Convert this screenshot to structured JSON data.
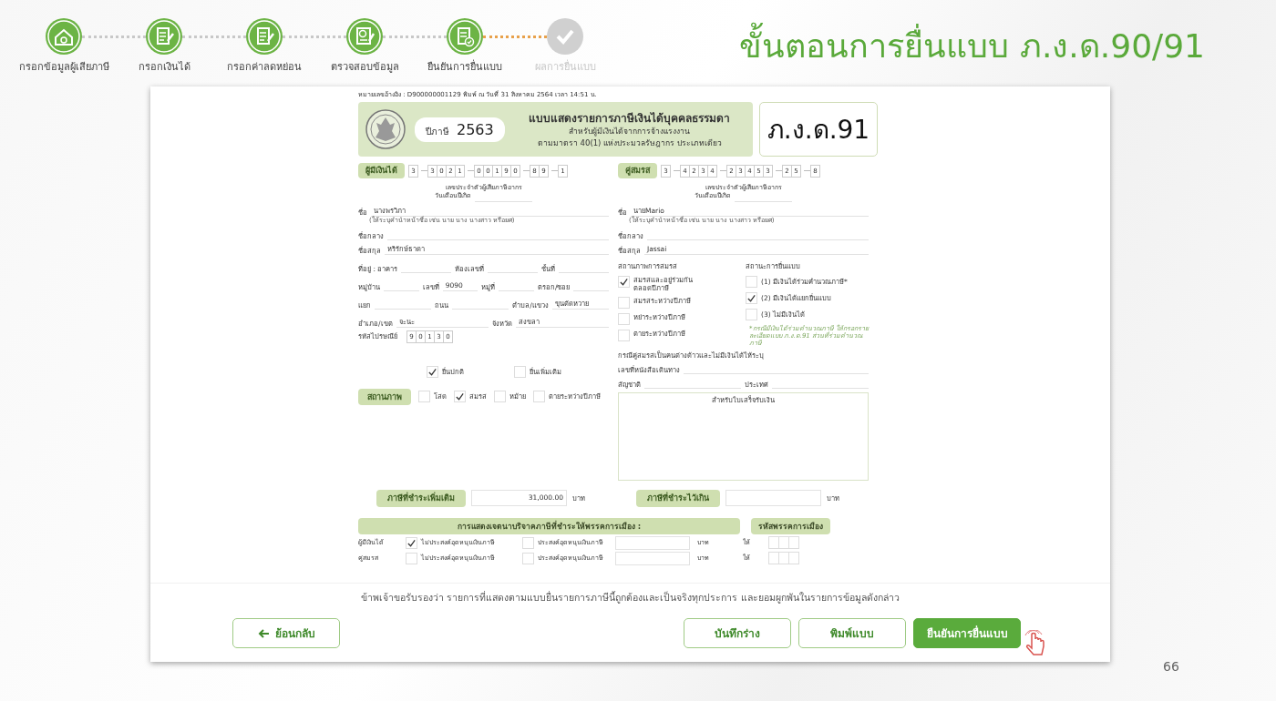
{
  "slide": {
    "title": "ขั้นตอนการยื่นแบบ ภ.ง.ด.90/91",
    "page_number": "66"
  },
  "steps": [
    {
      "label": "กรอกข้อมูลผู้เสียภาษี",
      "completed": true
    },
    {
      "label": "กรอกเงินได้",
      "completed": true
    },
    {
      "label": "กรอกค่าลดหย่อน",
      "completed": true
    },
    {
      "label": "ตรวจสอบข้อมูล",
      "completed": true
    },
    {
      "label": "ยืนยันการยื่นแบบ",
      "completed": true
    },
    {
      "label": "ผลการยื่นแบบ",
      "completed": false
    }
  ],
  "form": {
    "reference": "หมายเลขอ้างอิง : D900000001129  พิมพ์ ณ วันที่ 31 สิงหาคม 2564 เวลา 14:51 น.",
    "tax_year_label": "ปีภาษี",
    "tax_year": "2563",
    "title_lines": [
      "แบบแสดงรายการภาษีเงินได้บุคคลธรรมดา",
      "สำหรับผู้มีเงินได้จากการจ้างแรงงาน",
      "ตามมาตรา 40(1) แห่งประมวลรัษฎากร ประเภทเดียว"
    ],
    "form_code": "ภ.ง.ด.91",
    "persons": [
      {
        "label": "ผู้มีเงินได้",
        "tax_id": [
          [
            "3"
          ],
          [
            "3",
            "0",
            "2",
            "1"
          ],
          [
            "0",
            "0",
            "1",
            "9",
            "0"
          ],
          [
            "8",
            "9"
          ],
          [
            "1"
          ]
        ],
        "tax_id_caption": "เลขประจำตัวผู้เสียภาษีอากร",
        "birth_date_label": "วันเดือนปีเกิด",
        "name_label": "ชื่อ",
        "name": "นางพรวิภา",
        "name_hint": "(ให้ระบุคำนำหน้าชื่อ เช่น นาย นาง นางสาว หรือยศ)",
        "middle_name_label": "ชื่อกลาง",
        "surname_label": "ชื่อสกุล",
        "surname": "หริรักษ์ธาดา"
      },
      {
        "label": "คู่สมรส",
        "tax_id": [
          [
            "3"
          ],
          [
            "4",
            "2",
            "3",
            "4"
          ],
          [
            "2",
            "3",
            "4",
            "5",
            "3"
          ],
          [
            "2",
            "5"
          ],
          [
            "8"
          ]
        ],
        "tax_id_caption": "เลขประจำตัวผู้เสียภาษีอากร",
        "birth_date_label": "วันเดือนปีเกิด",
        "name_label": "ชื่อ",
        "name": "นายMario",
        "name_hint": "(ให้ระบุคำนำหน้าชื่อ เช่น นาย นาง นางสาว หรือยศ)",
        "middle_name_label": "ชื่อกลาง",
        "surname_label": "ชื่อสกุล",
        "surname": "Jassai"
      }
    ],
    "address_rows": [
      [
        {
          "label": "ที่อยู่ : อาคาร"
        },
        {
          "label": "ห้องเลขที่"
        },
        {
          "label": "ชั้นที่"
        }
      ],
      [
        {
          "label": "หมู่บ้าน"
        },
        {
          "label": "เลขที่",
          "value": "9090"
        },
        {
          "label": "หมู่ที่"
        },
        {
          "label": "ตรอก/ซอย"
        }
      ],
      [
        {
          "label": "แยก"
        },
        {
          "label": "ถนน"
        },
        {
          "label": "ตำบล/แขวง",
          "value": "ขุนตัดหวาย"
        }
      ],
      [
        {
          "label": "อำเภอ/เขต",
          "value": "จะนะ"
        },
        {
          "label": "จังหวัด",
          "value": "สงขลา"
        }
      ]
    ],
    "postal_code_label": "รหัสไปรษณีย์",
    "postal_code": [
      "9",
      "0",
      "1",
      "3",
      "0"
    ],
    "filing_types": [
      {
        "label": "ยื่นปกติ",
        "checked": true
      },
      {
        "label": "ยื่นเพิ่มเติม",
        "checked": false
      }
    ],
    "status_label": "สถานภาพ",
    "statuses": [
      {
        "label": "โสด",
        "checked": false
      },
      {
        "label": "สมรส",
        "checked": true
      },
      {
        "label": "หม้าย",
        "checked": false
      },
      {
        "label": "ตายระหว่างปีภาษี",
        "checked": false
      }
    ],
    "marital_status": {
      "title": "สถานภาพการสมรส",
      "options": [
        {
          "label": "สมรสและอยู่ร่วมกัน\nตลอดปีภาษี",
          "checked": true
        },
        {
          "label": "สมรสระหว่างปีภาษี",
          "checked": false
        },
        {
          "label": "หย่าระหว่างปีภาษี",
          "checked": false
        },
        {
          "label": "ตายระหว่างปีภาษี",
          "checked": false
        }
      ]
    },
    "filing_status": {
      "title": "สถานะการยื่นแบบ",
      "options": [
        {
          "label": "(1) มีเงินได้ร่วมคำนวณภาษี*",
          "checked": false
        },
        {
          "label": "(2) มีเงินได้แยกยื่นแบบ",
          "checked": true
        },
        {
          "label": "(3) ไม่มีเงินได้",
          "checked": false
        }
      ],
      "note": "*กรณีมีเงินได้ร่วมคำนวณภาษี ให้กรอกรายละเอียดแบบ ภ.ง.ด.91 ส่วนที่ร่วมคำนวณภาษี"
    },
    "foreign_note": "กรณีคู่สมรสเป็นคนต่างด้าวและไม่มีเงินได้ให้ระบุ",
    "passport_label": "เลขที่หนังสือเดินทาง",
    "nationality_label": "สัญชาติ",
    "country_label": "ประเทศ",
    "receipt_label": "สำหรับใบเสร็จรับเงิน",
    "tax_payable": {
      "label": "ภาษีที่ชำระเพิ่มเติม",
      "value": "31,000.00",
      "unit": "บาท"
    },
    "tax_overpaid": {
      "label": "ภาษีที่ชำระไว้เกิน",
      "unit": "บาท"
    },
    "donation": {
      "title": "การแสดงเจตนาบริจาคภาษีที่ชำระให้พรรคการเมือง :",
      "party_code_label": "รหัสพรรคการเมือง",
      "rows": [
        {
          "person": "ผู้มีเงินได้",
          "decline": {
            "label": "ไม่ประสงค์อุดหนุนเงินภาษี",
            "checked": true
          },
          "accept": {
            "label": "ประสงค์อุดหนุนเงินภาษี",
            "checked": false
          },
          "unit": "บาท",
          "give": "ให้"
        },
        {
          "person": "คู่สมรส",
          "decline": {
            "label": "ไม่ประสงค์อุดหนุนเงินภาษี",
            "checked": false
          },
          "accept": {
            "label": "ประสงค์อุดหนุนเงินภาษี",
            "checked": false
          },
          "unit": "บาท",
          "give": "ให้"
        }
      ]
    }
  },
  "declaration": "ข้าพเจ้าขอรับรองว่า รายการที่แสดงตามแบบยื่นรายการภาษีนี้ถูกต้องและเป็นจริงทุกประการ และยอมผูกพันในรายการข้อมูลดังกล่าว",
  "buttons": [
    {
      "label": "ย้อนกลับ",
      "kind": "back"
    },
    {
      "label": "บันทึกร่าง",
      "kind": "outline"
    },
    {
      "label": "พิมพ์แบบ",
      "kind": "outline"
    },
    {
      "label": "ยืนยันการยื่นแบบ",
      "kind": "primary"
    }
  ]
}
